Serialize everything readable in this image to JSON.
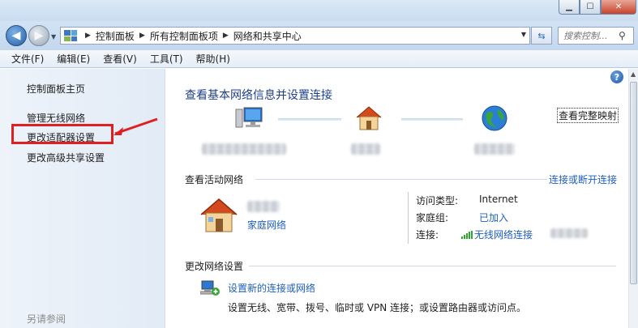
{
  "window": {
    "minimize": "▁",
    "maximize": "☐",
    "close": "✕"
  },
  "address": {
    "crumbs": [
      "控制面板",
      "所有控制面板项",
      "网络和共享中心"
    ],
    "search_placeholder": "搜索控制..."
  },
  "menu": [
    "文件(F)",
    "编辑(E)",
    "查看(V)",
    "工具(T)",
    "帮助(H)"
  ],
  "sidebar": {
    "items": [
      {
        "label": "控制面板主页"
      },
      {
        "label": "管理无线网络"
      },
      {
        "label": "更改适配器设置"
      },
      {
        "label": "更改高级共享设置"
      }
    ],
    "see_also": "另请参阅"
  },
  "main": {
    "heading": "查看基本网络信息并设置连接",
    "view_full_map": "查看完整映射",
    "active_networks_title": "查看活动网络",
    "connect_disconnect": "连接或断开连接",
    "network_type": "家庭网络",
    "properties": [
      {
        "key": "访问类型:",
        "value": "Internet"
      },
      {
        "key": "家庭组:",
        "value": "已加入"
      },
      {
        "key": "连接:",
        "value": "无线网络连接"
      }
    ],
    "change_settings_title": "更改网络设置",
    "setup_link": "设置新的连接或网络",
    "setup_desc": "设置无线、宽带、拨号、临时或 VPN 连接；或设置路由器或访问点。"
  },
  "colors": {
    "link": "#1f5fbb",
    "heading": "#1e3f88",
    "highlight": "#e02020",
    "wifi": "#2da82d"
  }
}
